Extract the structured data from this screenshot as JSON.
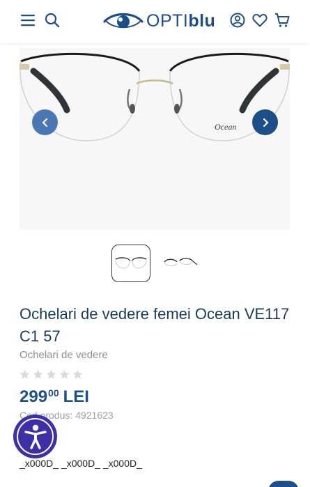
{
  "header": {
    "logo_text_light": "OPTI",
    "logo_text_bold": "blu",
    "icons": [
      "menu-icon",
      "search-icon",
      "account-icon",
      "wishlist-icon",
      "cart-icon"
    ]
  },
  "gallery": {
    "brand_mark": "Ocean",
    "thumbnails": 2,
    "active_thumbnail": 1
  },
  "product": {
    "title": "Ochelari de vedere femei Ocean VE117 C1 57",
    "category": "Ochelari de vedere",
    "rating": 0,
    "rating_max": 5,
    "price_integer": "299",
    "price_decimal": "00",
    "currency": "LEI",
    "code_text": "Cod produs: 4921623",
    "description_raw": "_x000D_ _x000D_ _x000D_"
  },
  "colors": {
    "brand_blue": "#1c4f87",
    "prev_button": "#4b78b5",
    "accessibility_purple": "#3d2fa8",
    "star_empty": "#d9d9d9"
  }
}
